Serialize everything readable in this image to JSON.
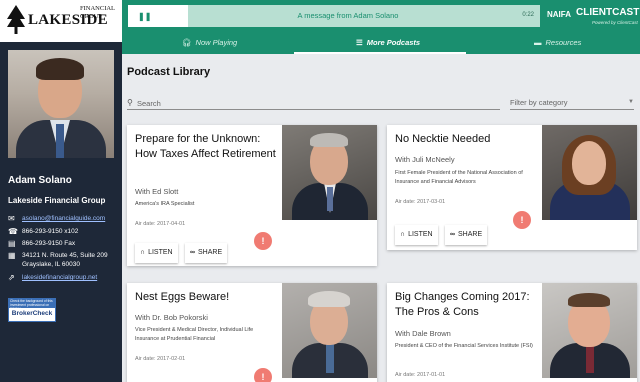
{
  "sidebar": {
    "logo": {
      "main": "LAKESIDE",
      "small_line1": "FINANCIAL",
      "small_line2": "GROUP"
    },
    "advisor_name": "Adam Solano",
    "company": "Lakeside Financial Group",
    "email": "asolano@financialguide.com",
    "phone": "866-293-9150 x102",
    "fax": "866-293-9150 Fax",
    "address_line1": "34121 N. Route 45, Suite 209",
    "address_line2": "Grayslake, IL 60030",
    "website": "lakesidefinancialgroup.net",
    "broker_check": {
      "top": "Check the background of this investment professional on FINRA's",
      "label": "BrokerCheck"
    }
  },
  "player": {
    "pause_icon": "pause-icon",
    "message": "A message from Adam Solano",
    "time": "0:22",
    "naifa": "NAIFA",
    "clientcast": "CLIENTCAST",
    "clientcast_sub": "Powered by ClientCast"
  },
  "tabs": [
    {
      "label": "Now Playing",
      "icon": "headphones-icon"
    },
    {
      "label": "More Podcasts",
      "icon": "list-icon"
    },
    {
      "label": "Resources",
      "icon": "folder-icon"
    }
  ],
  "library": {
    "title": "Podcast Library",
    "search_placeholder": "Search",
    "filter_placeholder": "Filter by category",
    "listen_label": "LISTEN",
    "share_label": "SHARE",
    "podcasts": [
      {
        "title": "Prepare for the Unknown: How Taxes Affect Retirement",
        "guest": "With Ed Slott",
        "guest_desc": "America's IRA Specialist",
        "air_date": "Air date: 2017-04-01"
      },
      {
        "title": "No Necktie Needed",
        "guest": "With Juli McNeely",
        "guest_desc": "First Female President of the National Association of Insurance and Financial Advisors",
        "air_date": "Air date: 2017-03-01"
      },
      {
        "title": "Nest Eggs Beware!",
        "guest": "With Dr. Bob Pokorski",
        "guest_desc": "Vice President & Medical Director, Individual Life Insurance at Prudential Financial",
        "air_date": "Air date: 2017-02-01"
      },
      {
        "title": "Big Changes Coming 2017: The Pros & Cons",
        "guest": "With Dale Brown",
        "guest_desc": "President & CEO of the Financial Services Institute (FSI)",
        "air_date": "Air date: 2017-01-01"
      }
    ]
  }
}
